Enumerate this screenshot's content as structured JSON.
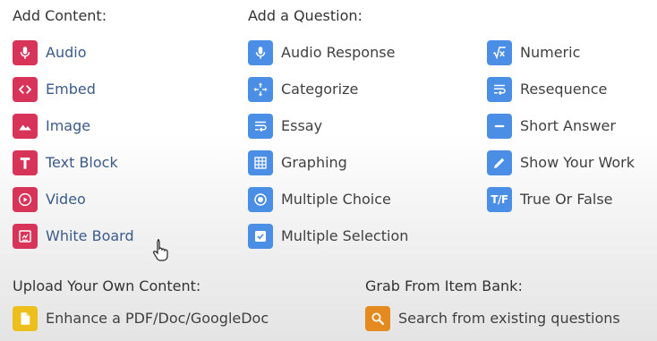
{
  "add_content": {
    "heading": "Add Content:",
    "items": [
      {
        "label": "Audio",
        "icon": "microphone-icon"
      },
      {
        "label": "Embed",
        "icon": "code-brackets-icon"
      },
      {
        "label": "Image",
        "icon": "mountain-image-icon"
      },
      {
        "label": "Text Block",
        "icon": "letter-t-icon"
      },
      {
        "label": "Video",
        "icon": "play-circle-icon"
      },
      {
        "label": "White Board",
        "icon": "whiteboard-icon"
      }
    ]
  },
  "add_question": {
    "heading": "Add a Question:",
    "col1": [
      {
        "label": "Audio Response",
        "icon": "microphone-icon"
      },
      {
        "label": "Categorize",
        "icon": "arrows-move-icon"
      },
      {
        "label": "Essay",
        "icon": "wrap-text-icon"
      },
      {
        "label": "Graphing",
        "icon": "grid-icon"
      },
      {
        "label": "Multiple Choice",
        "icon": "radio-icon"
      },
      {
        "label": "Multiple Selection",
        "icon": "checkbox-icon"
      }
    ],
    "col2": [
      {
        "label": "Numeric",
        "icon": "square-root-icon"
      },
      {
        "label": "Resequence",
        "icon": "wrap-text-icon"
      },
      {
        "label": "Short Answer",
        "icon": "short-line-icon"
      },
      {
        "label": "Show Your Work",
        "icon": "pencil-icon"
      },
      {
        "label": "True Or False",
        "icon": "true-false-icon",
        "glyph": "T/F"
      }
    ]
  },
  "upload": {
    "heading": "Upload Your Own Content:",
    "label": "Enhance a PDF/Doc/GoogleDoc",
    "icon": "document-icon"
  },
  "item_bank": {
    "heading": "Grab From Item Bank:",
    "label": "Search from existing questions",
    "icon": "search-icon"
  },
  "colors": {
    "content": "#d8345a",
    "question": "#4b8ee6",
    "upload": "#ecbf1d",
    "item_bank": "#e48a1f"
  }
}
